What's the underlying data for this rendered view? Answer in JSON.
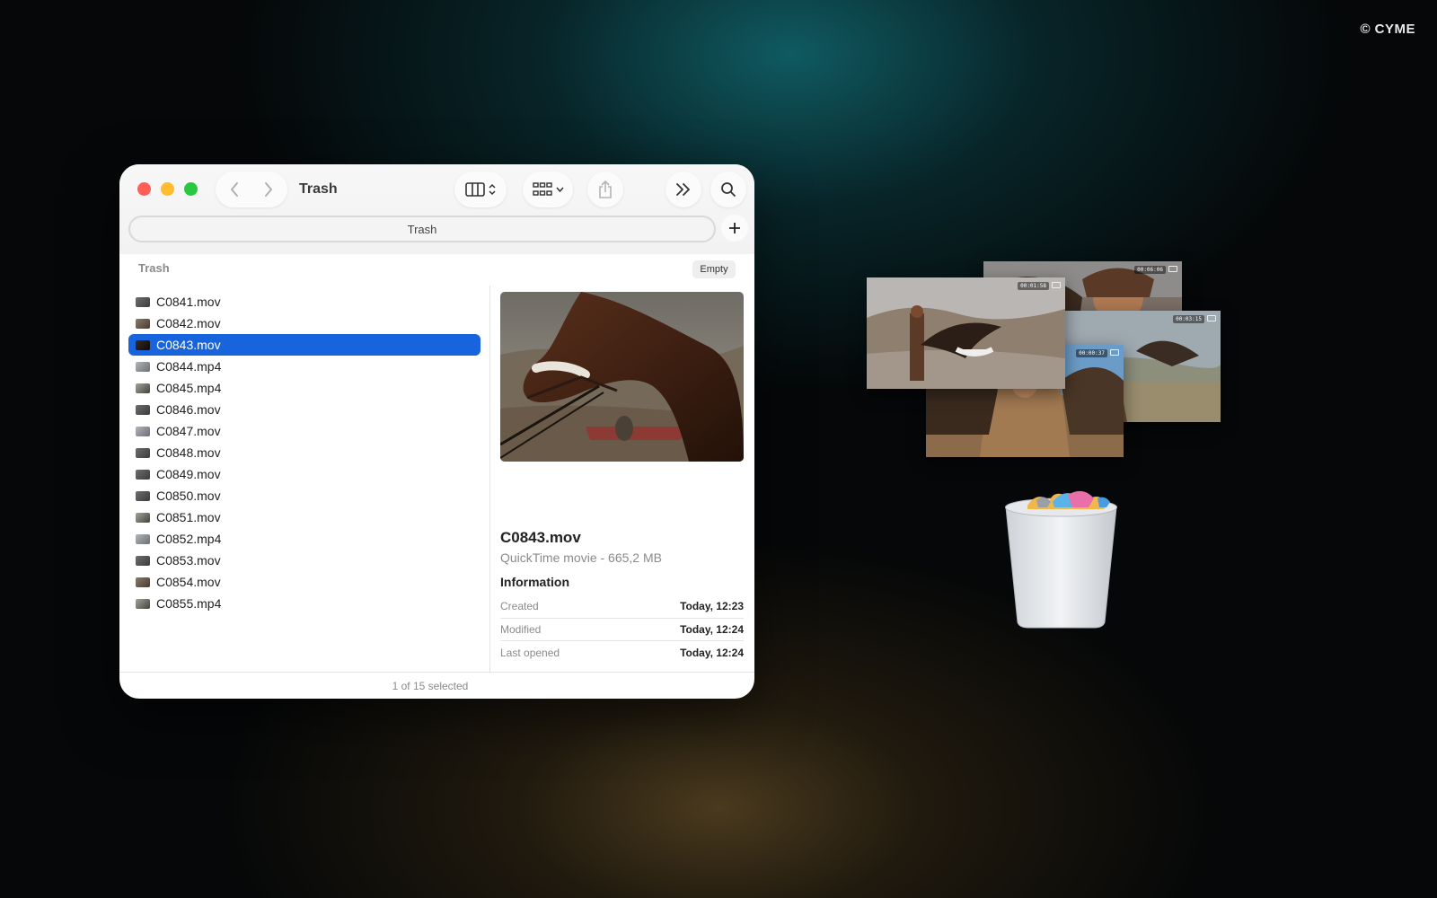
{
  "watermark": "© CYME",
  "window": {
    "title": "Trash",
    "path": "Trash",
    "section_label": "Trash",
    "empty_label": "Empty",
    "status": "1 of 15 selected"
  },
  "files": [
    {
      "name": "C0841.mov",
      "selected": false
    },
    {
      "name": "C0842.mov",
      "selected": false
    },
    {
      "name": "C0843.mov",
      "selected": true
    },
    {
      "name": "C0844.mp4",
      "selected": false
    },
    {
      "name": "C0845.mp4",
      "selected": false
    },
    {
      "name": "C0846.mov",
      "selected": false
    },
    {
      "name": "C0847.mov",
      "selected": false
    },
    {
      "name": "C0848.mov",
      "selected": false
    },
    {
      "name": "C0849.mov",
      "selected": false
    },
    {
      "name": "C0850.mov",
      "selected": false
    },
    {
      "name": "C0851.mov",
      "selected": false
    },
    {
      "name": "C0852.mp4",
      "selected": false
    },
    {
      "name": "C0853.mov",
      "selected": false
    },
    {
      "name": "C0854.mov",
      "selected": false
    },
    {
      "name": "C0855.mp4",
      "selected": false
    }
  ],
  "preview": {
    "name": "C0843.mov",
    "kind": "QuickTime movie - 665,2 MB",
    "info_heading": "Information",
    "info": [
      {
        "key": "Created",
        "value": "Today, 12:23"
      },
      {
        "key": "Modified",
        "value": "Today, 12:24"
      },
      {
        "key": "Last opened",
        "value": "Today, 12:24"
      }
    ]
  },
  "floating_cards": {
    "durations": [
      "00:06:06",
      "00:01:58",
      "00:03:15",
      "00:00:37"
    ]
  },
  "colors": {
    "selection": "#1864dc",
    "close": "#ff5f57",
    "minimize": "#febc2e",
    "maximize": "#28c840"
  }
}
